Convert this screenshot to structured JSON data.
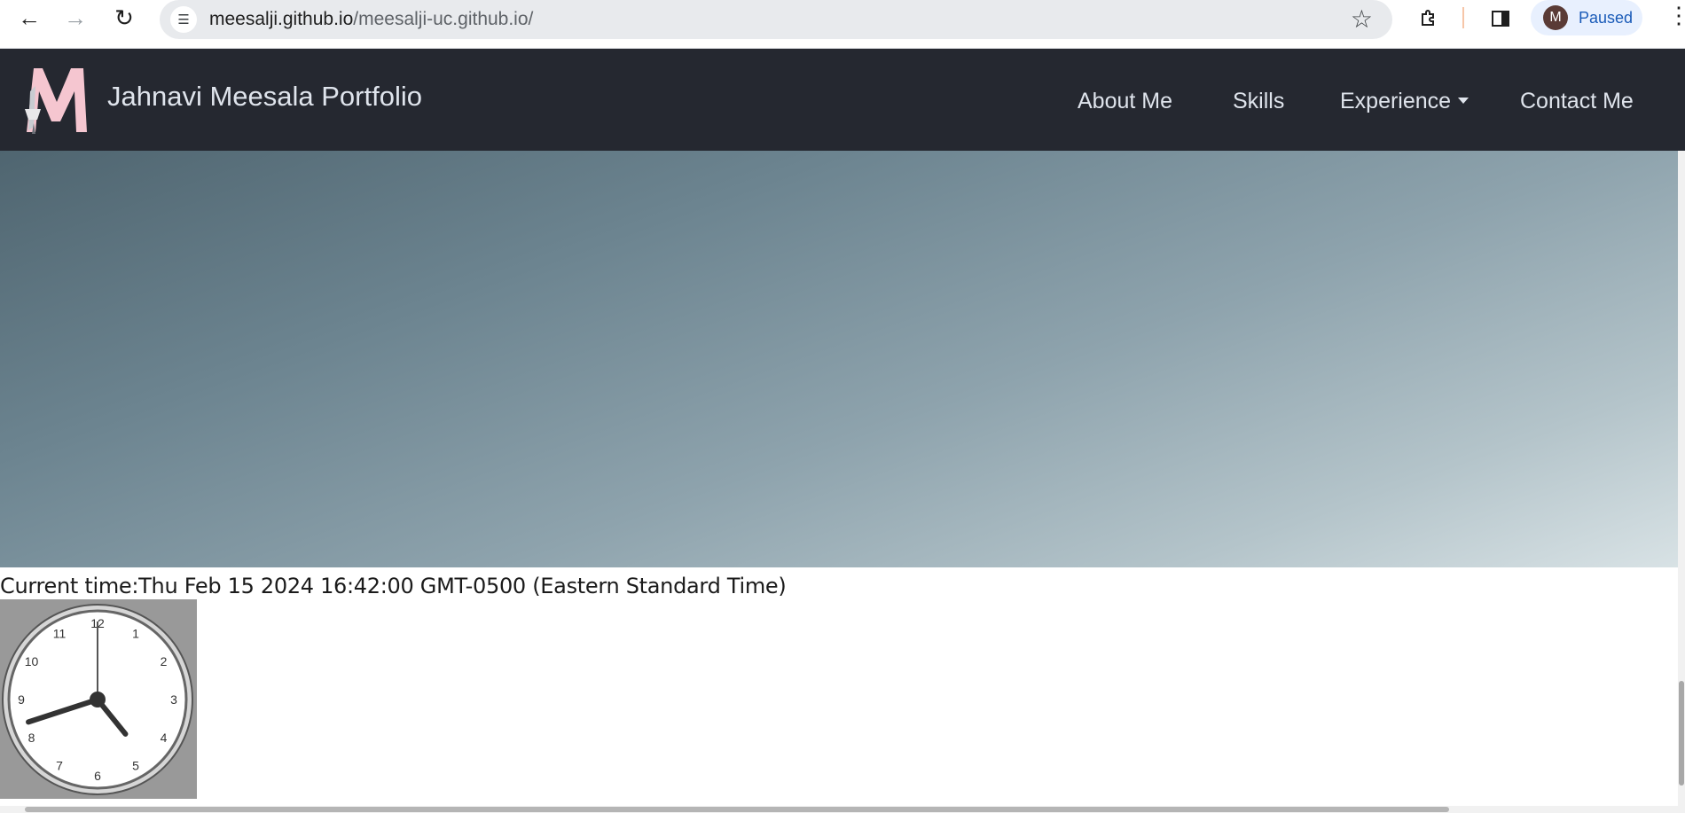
{
  "browser": {
    "url_host": "meesalji.github.io",
    "url_path": "/meesalji-uc.github.io/",
    "profile_initial": "M",
    "profile_status": "Paused",
    "icons": [
      "back-arrow-icon",
      "forward-arrow-icon",
      "reload-icon",
      "site-info-icon",
      "star-icon",
      "extensions-icon",
      "side-panel-icon",
      "more-menu-icon"
    ]
  },
  "navbar": {
    "brand": "Jahnavi Meesala Portfolio",
    "logo_letter": "M",
    "links": [
      "About Me",
      "Skills",
      "Experience",
      "Contact Me"
    ]
  },
  "content": {
    "time_text": "Current time:Thu Feb 15 2024 16:42:00 GMT-0500 (Eastern Standard Time)",
    "clock": {
      "hour": 16,
      "minute": 42,
      "second": 0,
      "numerals": [
        "12",
        "1",
        "2",
        "3",
        "4",
        "5",
        "6",
        "7",
        "8",
        "9",
        "10",
        "11"
      ]
    }
  },
  "colors": {
    "navbar_bg": "#252830",
    "logo_pink": "#f5c6d0",
    "link": "#dfe4ec",
    "clock_bg": "#999999"
  }
}
